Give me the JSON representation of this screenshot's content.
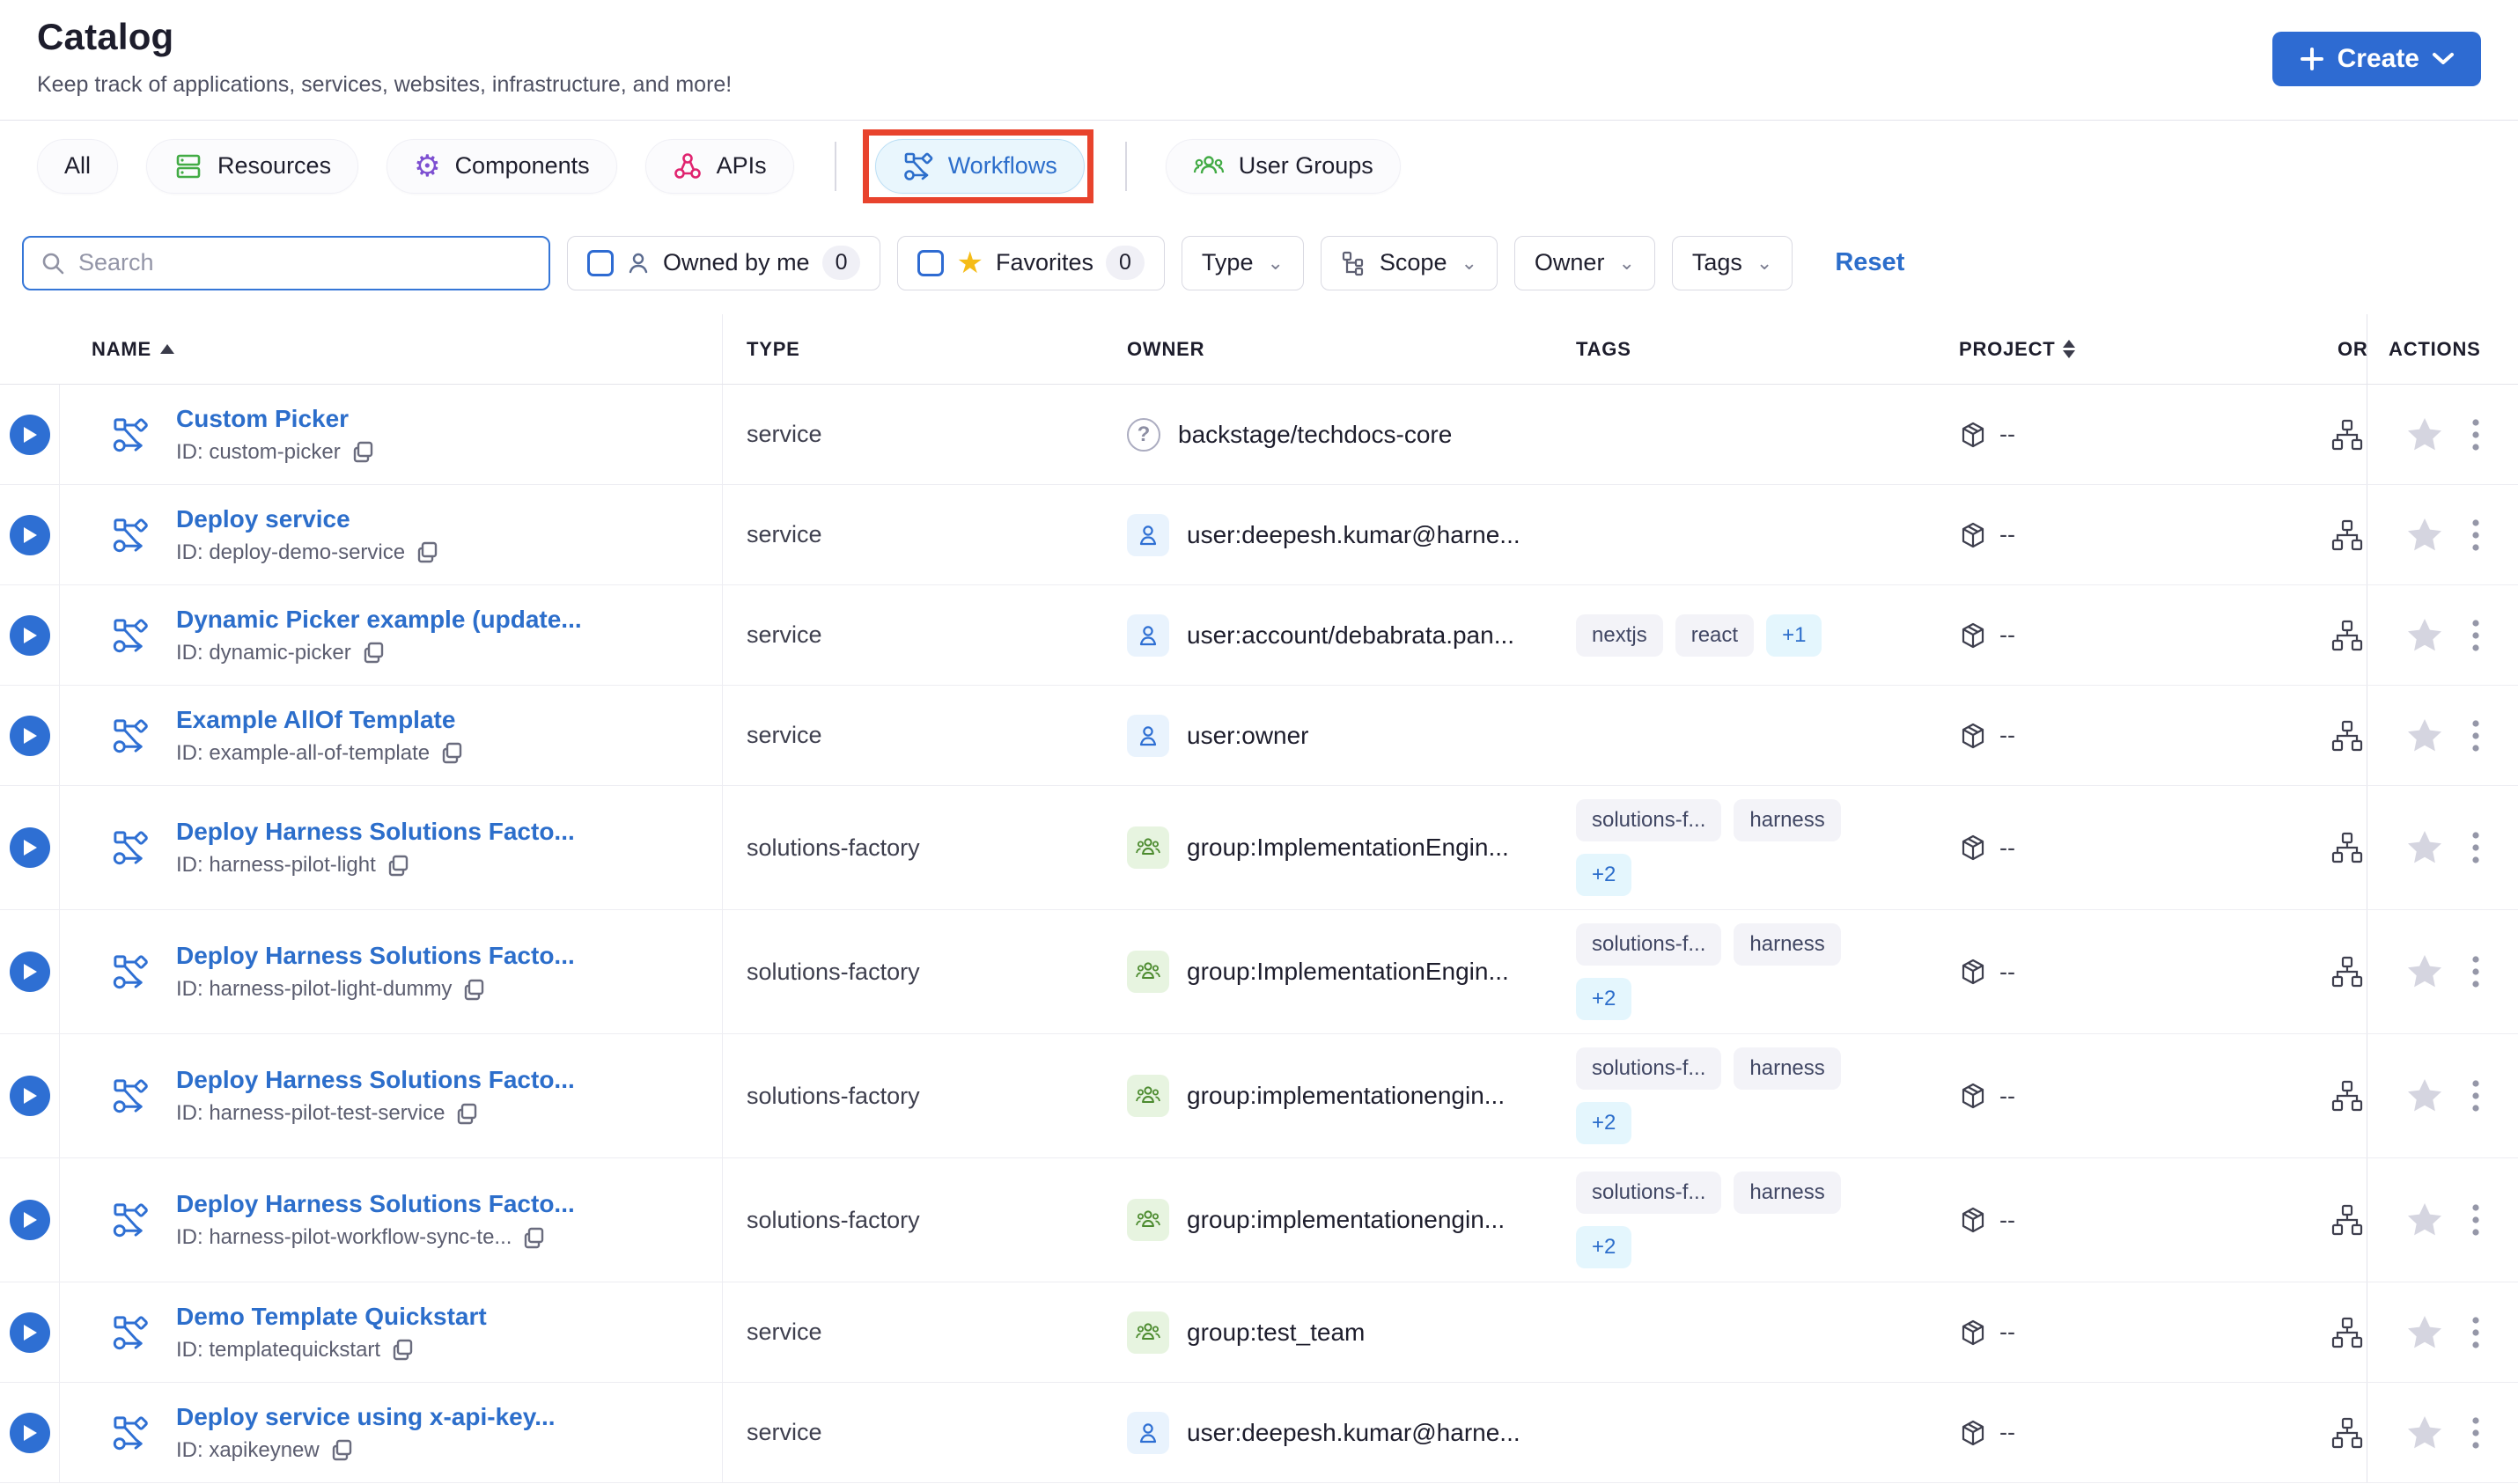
{
  "page": {
    "title": "Catalog",
    "subtitle": "Keep track of applications, services, websites, infrastructure, and more!"
  },
  "create_button": {
    "label": "Create"
  },
  "tabs": [
    {
      "label": "All",
      "icon": "none"
    },
    {
      "label": "Resources",
      "icon": "server-rack-icon",
      "icon_color": "#42ab45"
    },
    {
      "label": "Components",
      "icon": "gear-icon",
      "icon_color": "#7d4fd1"
    },
    {
      "label": "APIs",
      "icon": "api-nodes-icon",
      "icon_color": "#e0236f"
    },
    {
      "label": "Workflows",
      "icon": "workflow-icon",
      "icon_color": "#2c6ecb",
      "active": true,
      "annotated_with_red_box": true
    },
    {
      "label": "User Groups",
      "icon": "user-groups-icon",
      "icon_color": "#42ab45"
    }
  ],
  "filters": {
    "search_placeholder": "Search",
    "owned_by_me": {
      "label": "Owned by me",
      "count": "0",
      "checked": false
    },
    "favorites": {
      "label": "Favorites",
      "count": "0",
      "checked": false
    },
    "type_dropdown": "Type",
    "scope_dropdown": "Scope",
    "owner_dropdown": "Owner",
    "tags_dropdown": "Tags",
    "reset_label": "Reset"
  },
  "table": {
    "columns": {
      "name": "NAME",
      "type": "TYPE",
      "owner": "OWNER",
      "tags": "TAGS",
      "project": "PROJECT",
      "org": "OR",
      "actions": "ACTIONS"
    },
    "rows": [
      {
        "name": "Custom Picker",
        "id": "ID: custom-picker",
        "type": "service",
        "owner": {
          "kind": "help",
          "icon": "help-icon",
          "text": "backstage/techdocs-core"
        },
        "tags": [],
        "more": "",
        "project": "--",
        "tall": false
      },
      {
        "name": "Deploy service",
        "id": "ID: deploy-demo-service",
        "type": "service",
        "owner": {
          "kind": "user",
          "icon": "user-icon",
          "text": "user:deepesh.kumar@harne..."
        },
        "tags": [],
        "more": "",
        "project": "--",
        "tall": false
      },
      {
        "name": "Dynamic Picker example (update...",
        "id": "ID: dynamic-picker",
        "type": "service",
        "owner": {
          "kind": "user",
          "icon": "user-icon",
          "text": "user:account/debabrata.pan..."
        },
        "tags": [
          "nextjs",
          "react"
        ],
        "more": "+1",
        "project": "--",
        "tall": false
      },
      {
        "name": "Example AllOf Template",
        "id": "ID: example-all-of-template",
        "type": "service",
        "owner": {
          "kind": "user",
          "icon": "user-icon",
          "text": "user:owner"
        },
        "tags": [],
        "more": "",
        "project": "--",
        "tall": false
      },
      {
        "name": "Deploy Harness Solutions Facto...",
        "id": "ID: harness-pilot-light",
        "type": "solutions-factory",
        "owner": {
          "kind": "group",
          "icon": "group-icon",
          "text": "group:ImplementationEngin..."
        },
        "tags": [
          "solutions-f...",
          "harness"
        ],
        "more": "+2",
        "project": "--",
        "tall": true
      },
      {
        "name": "Deploy Harness Solutions Facto...",
        "id": "ID: harness-pilot-light-dummy",
        "type": "solutions-factory",
        "owner": {
          "kind": "group",
          "icon": "group-icon",
          "text": "group:ImplementationEngin..."
        },
        "tags": [
          "solutions-f...",
          "harness"
        ],
        "more": "+2",
        "project": "--",
        "tall": true
      },
      {
        "name": "Deploy Harness Solutions Facto...",
        "id": "ID: harness-pilot-test-service",
        "type": "solutions-factory",
        "owner": {
          "kind": "group",
          "icon": "group-icon",
          "text": "group:implementationengin..."
        },
        "tags": [
          "solutions-f...",
          "harness"
        ],
        "more": "+2",
        "project": "--",
        "tall": true
      },
      {
        "name": "Deploy Harness Solutions Facto...",
        "id": "ID: harness-pilot-workflow-sync-te...",
        "type": "solutions-factory",
        "owner": {
          "kind": "group",
          "icon": "group-icon",
          "text": "group:implementationengin..."
        },
        "tags": [
          "solutions-f...",
          "harness"
        ],
        "more": "+2",
        "project": "--",
        "tall": true
      },
      {
        "name": "Demo Template Quickstart",
        "id": "ID: templatequickstart",
        "type": "service",
        "owner": {
          "kind": "group",
          "icon": "group-icon",
          "text": "group:test_team"
        },
        "tags": [],
        "more": "",
        "project": "--",
        "tall": false
      },
      {
        "name": "Deploy service using x-api-key...",
        "id": "ID: xapikeynew",
        "type": "service",
        "owner": {
          "kind": "user",
          "icon": "user-icon",
          "text": "user:deepesh.kumar@harne..."
        },
        "tags": [],
        "more": "",
        "project": "--",
        "tall": false
      }
    ]
  }
}
